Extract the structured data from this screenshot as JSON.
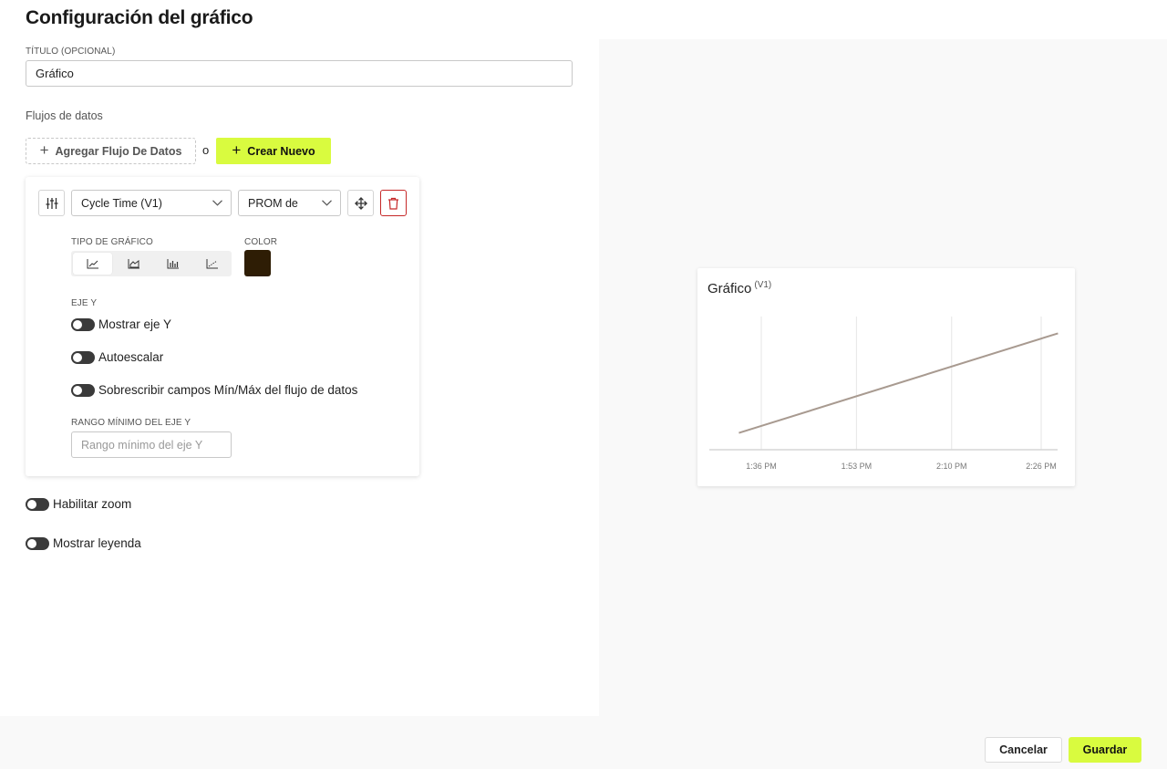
{
  "page": {
    "title": "Configuración del gráfico"
  },
  "form": {
    "title_label": "TÍTULO (OPCIONAL)",
    "title_value": "Gráfico",
    "streams_label": "Flujos de datos",
    "add_stream_label": "Agregar Flujo De Datos",
    "or_label": "o",
    "create_new_label": "Crear Nuevo"
  },
  "stream": {
    "stream_select": "Cycle Time (V1)",
    "aggregate_select": "PROM de",
    "chart_type_label": "TIPO DE GRÁFICO",
    "chart_types": [
      "line-chart-icon",
      "area-chart-icon",
      "bar-chart-icon",
      "scatter-chart-icon"
    ],
    "chart_type_selected": "line",
    "color_label": "COLOR",
    "color": "#2e1d05",
    "y_axis_label": "EJE Y",
    "show_y_axis": "Mostrar eje Y",
    "autoscale": "Autoescalar",
    "override_minmax": "Sobrescribir campos Mín/Máx del flujo de datos",
    "y_min_label": "RANGO MÍNIMO DEL EJE Y",
    "y_min_placeholder": "Rango mínimo del eje Y"
  },
  "options": {
    "enable_zoom": "Habilitar zoom",
    "show_legend": "Mostrar leyenda"
  },
  "preview": {
    "title": "Gráfico",
    "title_sup": "(V1)"
  },
  "footer": {
    "cancel_label": "Cancelar",
    "save_label": "Guardar"
  },
  "chart_data": {
    "type": "line",
    "title": "Gráfico (V1)",
    "xlabel": "",
    "ylabel": "",
    "x_ticks": [
      "1:36 PM",
      "1:53 PM",
      "2:10 PM",
      "2:26 PM"
    ],
    "x_tick_minutes": [
      0,
      17,
      34,
      50
    ],
    "series": [
      {
        "color": "#a89a90",
        "points": [
          [
            -4,
            0.08
          ],
          [
            53,
            0.92
          ]
        ]
      }
    ],
    "y_axis_visible": false,
    "grid": "vertical"
  }
}
